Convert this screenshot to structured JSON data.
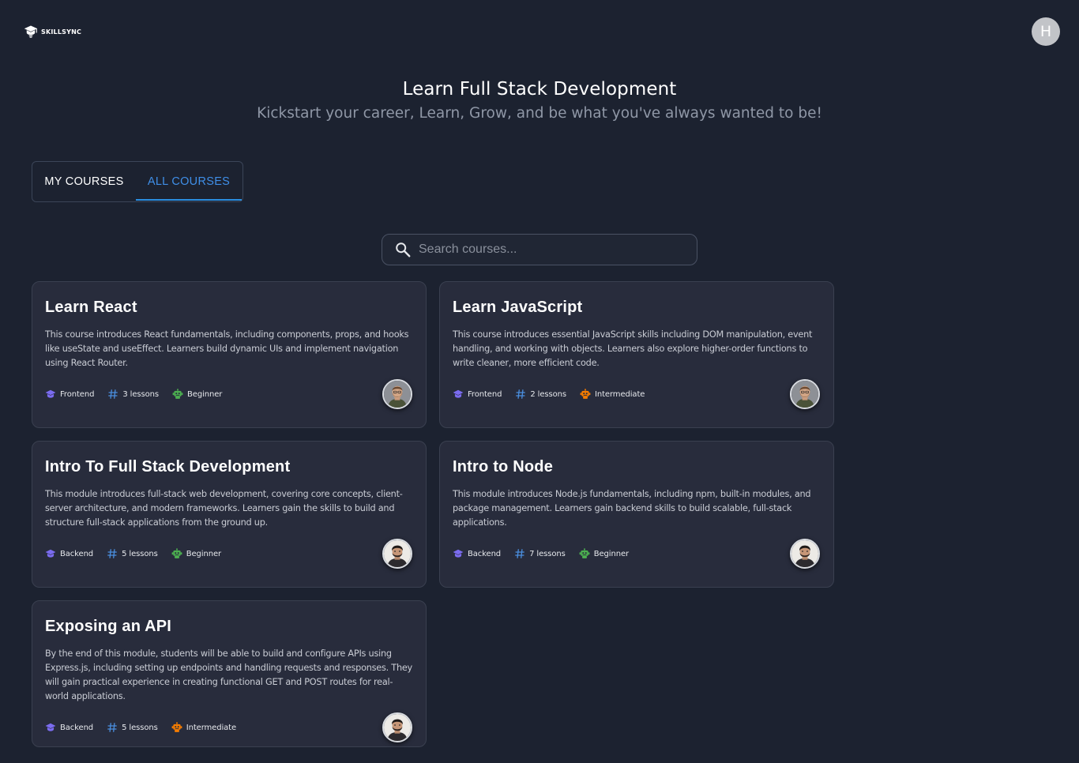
{
  "header": {
    "logo_text": "SKILLSYNC",
    "user_initial": "H"
  },
  "hero": {
    "title": "Learn Full Stack Development",
    "subtitle": "Kickstart your career, Learn, Grow, and be what you've always wanted to be!"
  },
  "tabs": [
    {
      "label": "MY COURSES",
      "active": false
    },
    {
      "label": "ALL COURSES",
      "active": true
    }
  ],
  "search": {
    "placeholder": "Search courses..."
  },
  "colors": {
    "accent": "#3f8fe8",
    "category_icon": "#7b6cf0",
    "lessons_icon": "#4a8fe0",
    "beginner_icon": "#4caf50",
    "intermediate_icon": "#f57c00"
  },
  "courses": [
    {
      "title": "Learn React",
      "description": "This course introduces React fundamentals, including components, props, and hooks like useState and useEffect. Learners build dynamic UIs and implement navigation using React Router.",
      "category": "Frontend",
      "lessons": "3 lessons",
      "level": "Beginner",
      "category_icon": "graduation-cap-icon",
      "lessons_icon": "hash-icon",
      "level_icon": "robot-icon",
      "instructor_avatar": "instructor-avatar-bearded"
    },
    {
      "title": "Learn JavaScript",
      "description": "This course introduces essential JavaScript skills including DOM manipulation, event handling, and working with objects. Learners also explore higher-order functions to write cleaner, more efficient code.",
      "category": "Frontend",
      "lessons": "2 lessons",
      "level": "Intermediate",
      "category_icon": "graduation-cap-icon",
      "lessons_icon": "hash-icon",
      "level_icon": "robot-icon",
      "instructor_avatar": "instructor-avatar-bearded"
    },
    {
      "title": "Intro To Full Stack Development",
      "description": "This module introduces full-stack web development, covering core concepts, client-server architecture, and modern frameworks. Learners gain the skills to build and structure full-stack applications from the ground up.",
      "category": "Backend",
      "lessons": "5 lessons",
      "level": "Beginner",
      "category_icon": "graduation-cap-icon",
      "lessons_icon": "hash-icon",
      "level_icon": "robot-icon",
      "instructor_avatar": "instructor-avatar-dark-hair"
    },
    {
      "title": "Intro to Node",
      "description": "This module introduces Node.js fundamentals, including npm, built-in modules, and package management. Learners gain backend skills to build scalable, full-stack applications.",
      "category": "Backend",
      "lessons": "7 lessons",
      "level": "Beginner",
      "category_icon": "graduation-cap-icon",
      "lessons_icon": "hash-icon",
      "level_icon": "robot-icon",
      "instructor_avatar": "instructor-avatar-dark-hair"
    },
    {
      "title": "Exposing an API",
      "description": "By the end of this module, students will be able to build and configure APIs using Express.js, including setting up endpoints and handling requests and responses. They will gain practical experience in creating functional GET and POST routes for real-world applications.",
      "category": "Backend",
      "lessons": "5 lessons",
      "level": "Intermediate",
      "category_icon": "graduation-cap-icon",
      "lessons_icon": "hash-icon",
      "level_icon": "robot-icon",
      "instructor_avatar": "instructor-avatar-dark-hair"
    }
  ]
}
